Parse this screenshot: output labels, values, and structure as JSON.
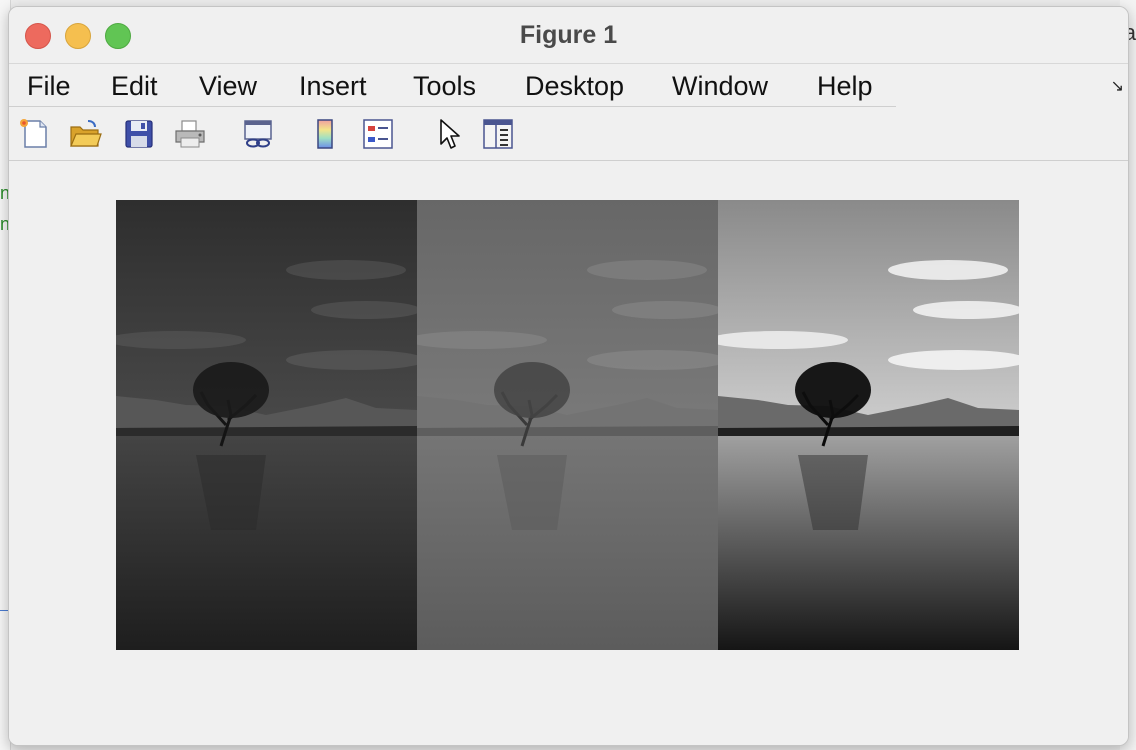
{
  "window": {
    "title": "Figure 1"
  },
  "menu": [
    "File",
    "Edit",
    "View",
    "Insert",
    "Tools",
    "Desktop",
    "Window",
    "Help"
  ],
  "toolbar": {
    "icons": [
      "new-figure-icon",
      "open-file-icon",
      "save-icon",
      "print-icon",
      "link-plot-icon",
      "colorbar-icon",
      "legend-icon",
      "pointer-icon",
      "property-inspector-icon"
    ]
  },
  "background": {
    "right_text": "a"
  },
  "panels": [
    {
      "name": "dark-contrast",
      "sky": "#3a3a3a",
      "sky_top": "#2e2e2e",
      "cloud": "#6a6a6a",
      "mountain": "#5c5c5c",
      "water": "#3b3b3b",
      "water_bottom": "#222222",
      "tree": "#141414"
    },
    {
      "name": "low-contrast",
      "sky": "#6e6e6e",
      "sky_top": "#666666",
      "cloud": "#8a8a8a",
      "mountain": "#737373",
      "water": "#6b6b6b",
      "water_bottom": "#5a5a5a",
      "tree": "#3a3a3a"
    },
    {
      "name": "high-contrast",
      "sky": "#b5b5b5",
      "sky_top": "#8e8e8e",
      "cloud": "#f2f2f2",
      "mountain": "#6a6a6a",
      "water": "#8a8a8a",
      "water_bottom": "#1c1c1c",
      "tree": "#0a0a0a"
    }
  ]
}
